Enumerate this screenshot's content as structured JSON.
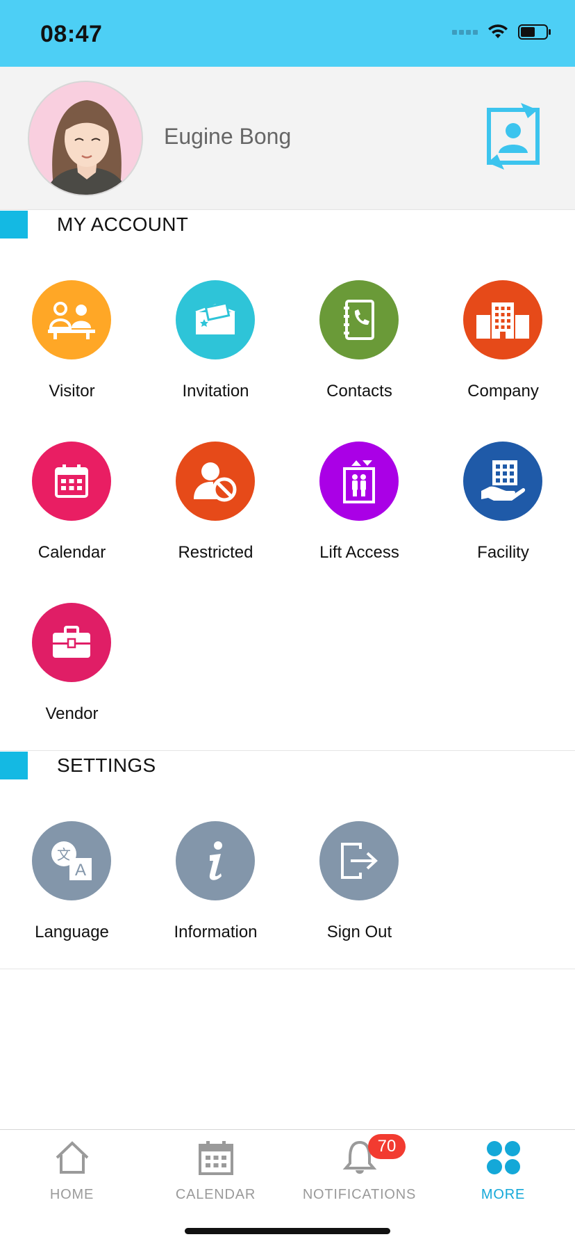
{
  "status_bar": {
    "time": "08:47"
  },
  "profile": {
    "name": "Eugine Bong",
    "switch_icon": "switch-account-icon"
  },
  "sections": {
    "account": {
      "title": "MY ACCOUNT",
      "items": [
        {
          "label": "Visitor",
          "icon": "visitor-icon",
          "color": "#ffa726"
        },
        {
          "label": "Invitation",
          "icon": "invitation-icon",
          "color": "#2ec4d8"
        },
        {
          "label": "Contacts",
          "icon": "contacts-icon",
          "color": "#6a9a38"
        },
        {
          "label": "Company",
          "icon": "company-icon",
          "color": "#e64a19"
        },
        {
          "label": "Calendar",
          "icon": "calendar-icon",
          "color": "#e91e63"
        },
        {
          "label": "Restricted",
          "icon": "restricted-icon",
          "color": "#e64a19"
        },
        {
          "label": "Lift Access",
          "icon": "lift-icon",
          "color": "#aa00e6"
        },
        {
          "label": "Facility",
          "icon": "facility-icon",
          "color": "#1f5aa8"
        },
        {
          "label": "Vendor",
          "icon": "vendor-icon",
          "color": "#e01e66"
        }
      ]
    },
    "settings": {
      "title": "SETTINGS",
      "items": [
        {
          "label": "Language",
          "icon": "language-icon",
          "color": "#8396aa"
        },
        {
          "label": "Information",
          "icon": "information-icon",
          "color": "#8396aa"
        },
        {
          "label": "Sign Out",
          "icon": "sign-out-icon",
          "color": "#8396aa"
        }
      ]
    }
  },
  "tabbar": {
    "tabs": [
      {
        "label": "HOME",
        "icon": "home-icon"
      },
      {
        "label": "CALENDAR",
        "icon": "calendar-tab-icon"
      },
      {
        "label": "NOTIFICATIONS",
        "icon": "bell-icon",
        "badge": "70"
      },
      {
        "label": "MORE",
        "icon": "more-icon",
        "active": true
      }
    ]
  },
  "colors": {
    "status_bar": "#4dcff5",
    "accent": "#14b9e3",
    "active_tab": "#14a8d8",
    "badge": "#f23b30"
  }
}
